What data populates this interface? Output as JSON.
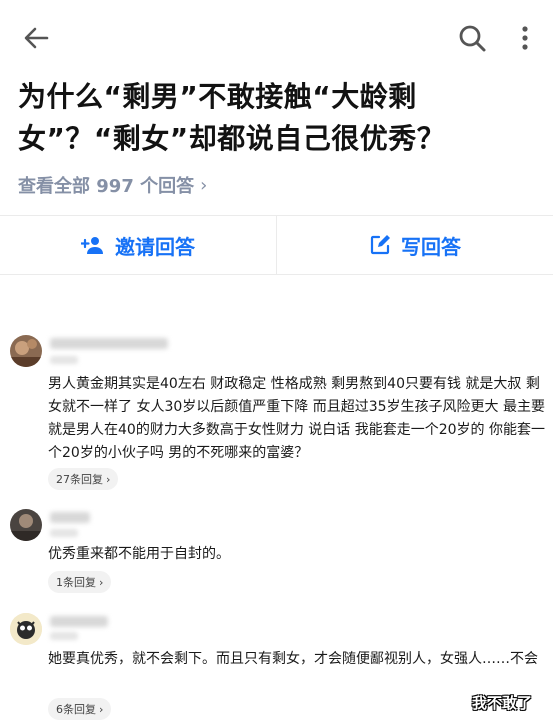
{
  "question": {
    "title": "为什么“剩男”不敢接触“大龄剩女”？“剩女”却都说自己很优秀？",
    "view_all": "查看全部 997 个回答",
    "chevron": "›"
  },
  "actions": {
    "invite": "邀请回答",
    "write": "写回答"
  },
  "comments": [
    {
      "text": "男人黄金期其实是40左右  财政稳定  性格成熟  剩男熬到40只要有钱  就是大叔  剩女就不一样了  女人30岁以后颜值严重下降  而且超过35岁生孩子风险更大  最主要就是男人在40的财力大多数高于女性财力  说白话  我能套走一个20岁的  你能套一个20岁的小伙子吗  男的不死哪来的富婆？",
      "replies": "27条回复"
    },
    {
      "text": "优秀重来都不能用于自封的。",
      "replies": "1条回复"
    },
    {
      "text": "她要真优秀，就不会剩下。而且只有剩女，才会随便鄙视别人，女强人……不会",
      "replies": "6条回复"
    }
  ],
  "watermark": "我不敢了",
  "colors": {
    "accent": "#1772f6",
    "muted": "#8590a6",
    "divider": "#ebebeb"
  }
}
